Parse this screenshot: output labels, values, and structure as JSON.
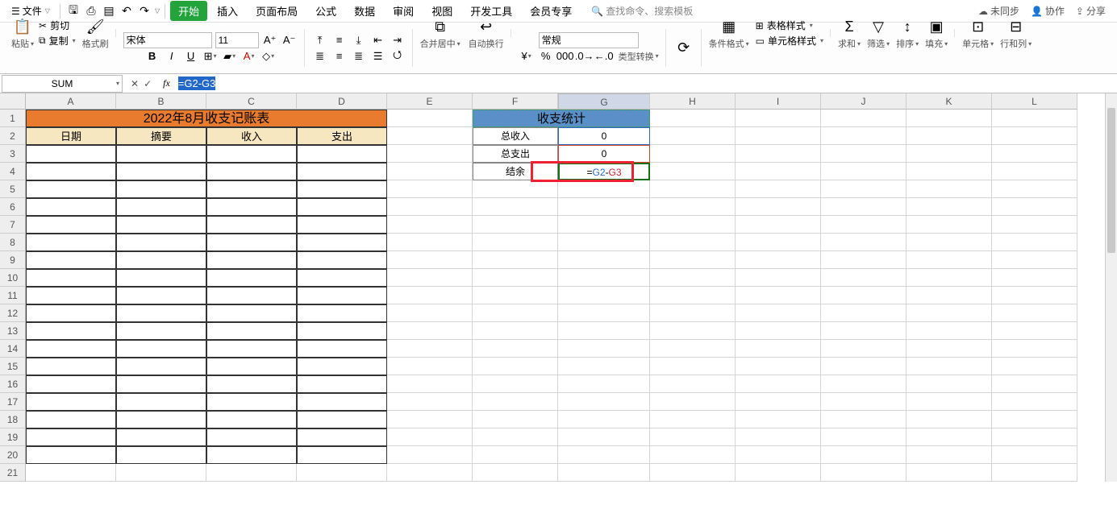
{
  "menu": {
    "file": "文件",
    "tabs": [
      "开始",
      "插入",
      "页面布局",
      "公式",
      "数据",
      "审阅",
      "视图",
      "开发工具",
      "会员专享"
    ],
    "active_tab_index": 0,
    "search_ph": "查找命令、搜索模板",
    "right": {
      "unsync": "未同步",
      "coop": "协作",
      "share": "分享"
    }
  },
  "ribbon": {
    "paste": "粘贴",
    "cut": "剪切",
    "copy": "复制",
    "fmtpaint": "格式刷",
    "font_name": "宋体",
    "font_size": "11",
    "merge": "合并居中",
    "wrap": "自动换行",
    "numfmt": "常规",
    "type_convert": "类型转换",
    "cond_fmt": "条件格式",
    "tbl_style": "表格样式",
    "cell_style": "单元格样式",
    "sum": "求和",
    "filter": "筛选",
    "sort": "排序",
    "fill": "填充",
    "cells": "单元格",
    "rowcol": "行和列"
  },
  "fbar": {
    "name": "SUM",
    "formula": "=G2-G3"
  },
  "cols": [
    "A",
    "B",
    "C",
    "D",
    "E",
    "F",
    "G",
    "H",
    "I",
    "J",
    "K",
    "L"
  ],
  "rowcount": 21,
  "sheet": {
    "title": "2022年8月收支记账表",
    "headers": [
      "日期",
      "摘要",
      "收入",
      "支出"
    ],
    "stat_title": "收支统计",
    "stat": [
      {
        "k": "总收入",
        "v": "0"
      },
      {
        "k": "总支出",
        "v": "0"
      },
      {
        "k": "结余",
        "v": "=G2-G3"
      }
    ]
  }
}
